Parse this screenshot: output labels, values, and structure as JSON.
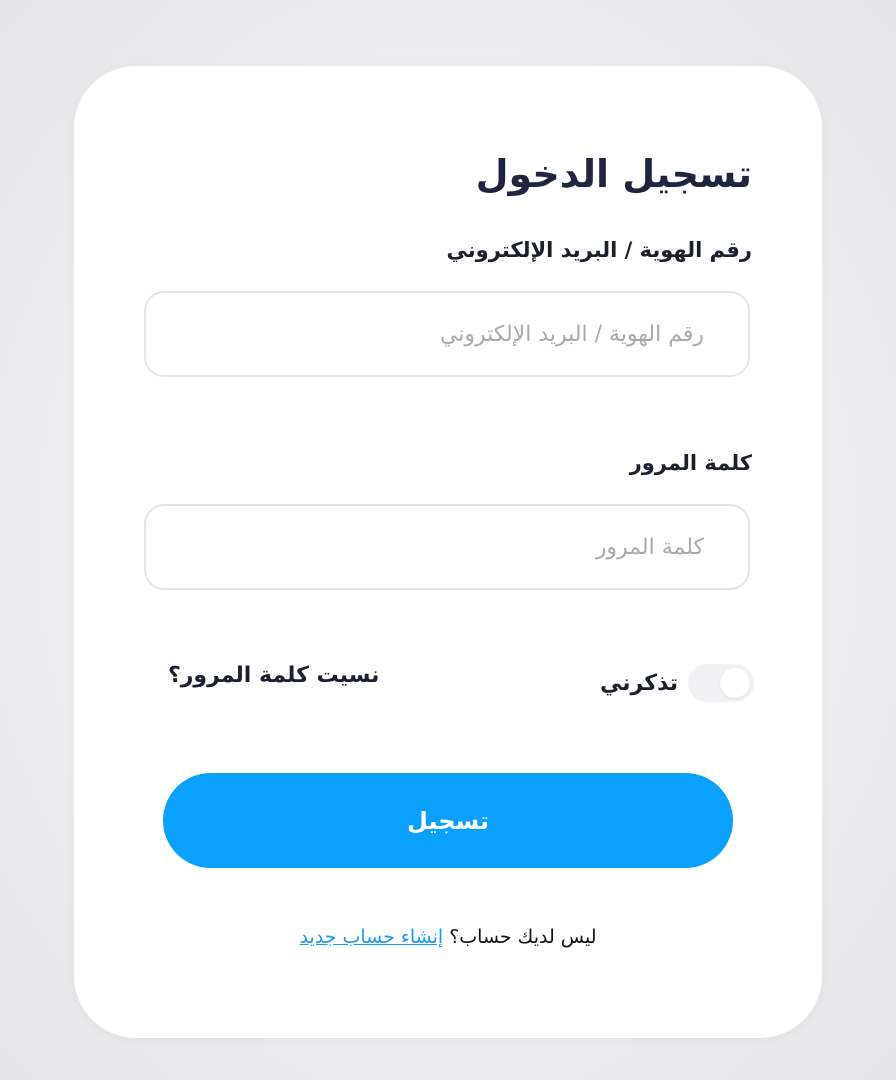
{
  "login": {
    "title": "تسجيل الدخول",
    "id_label": "رقم الهوية / البريد الإلكتروني",
    "id_placeholder": "رقم الهوية / البريد الإلكتروني",
    "id_value": "",
    "password_label": "كلمة المرور",
    "password_placeholder": "كلمة المرور",
    "password_value": "",
    "remember_label": "تذكرني",
    "remember_checked": false,
    "forgot_label": "نسيت كلمة المرور؟",
    "submit_label": "تسجيل",
    "no_account_text": "ليس لديك حساب؟",
    "signup_link": "إنشاء حساب جديد"
  },
  "colors": {
    "accent": "#0aa0fb",
    "link": "#1a9bf0",
    "title_text": "#1f2540"
  }
}
